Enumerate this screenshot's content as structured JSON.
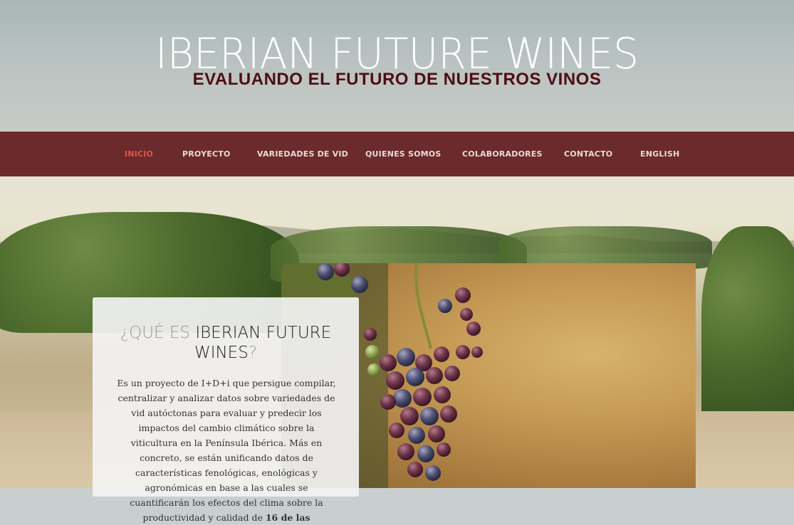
{
  "header": {
    "title": "IBERIAN FUTURE WINES",
    "subtitle": "EVALUANDO EL FUTURO DE NUESTROS VINOS"
  },
  "nav": {
    "items": [
      {
        "label": "INICIO",
        "active": true
      },
      {
        "label": "PROYECTO"
      },
      {
        "label": "VARIEDADES DE VID"
      },
      {
        "label": "QUIENES SOMOS"
      },
      {
        "label": "COLABORADORES"
      },
      {
        "label": "CONTACTO"
      },
      {
        "label": "ENGLISH"
      }
    ],
    "colors": {
      "background": "#6b2a2b",
      "text": "#e8d9d9",
      "active": "#e4554d"
    }
  },
  "intro": {
    "title_light": "¿QUÉ ES ",
    "title_strong": "IBERIAN FUTURE WINES",
    "title_end": "?",
    "text": "Es un proyecto de I+D+i que persigue compilar, centralizar y analizar datos sobre variedades de vid autóctonas para evaluar y predecir los impactos del cambio climático sobre la viticultura en la Península Ibérica. Más en concreto, se están unificando datos de características fenológicas, enológicas y agronómicas en base a las cuales se cuantificarán los efectos del clima sobre la productividad y calidad de ",
    "text_bold": "16 de las"
  },
  "images": {
    "background": "vineyard-photo",
    "feature": "red-grapes-photo"
  }
}
